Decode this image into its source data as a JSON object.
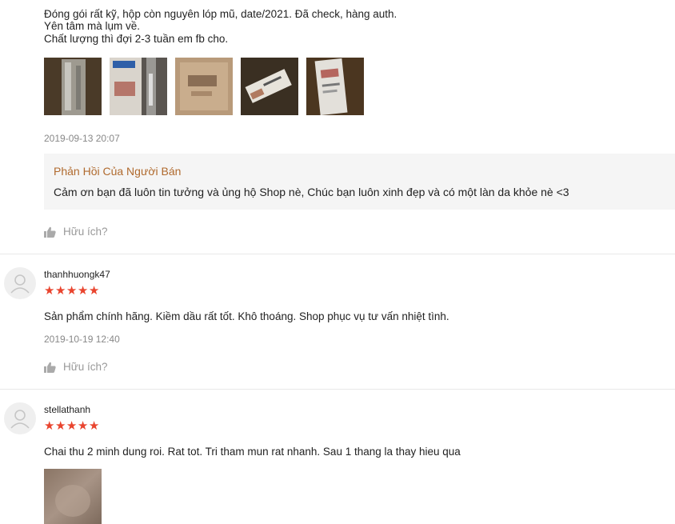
{
  "review1": {
    "lines": [
      "Đóng gói rất kỹ, hộp còn nguyên lóp mũ, date/2021. Đã check, hàng auth.",
      "Yên tâm mà lụm về.",
      "Chất lượng thì đợi 2-3 tuần em fb cho."
    ],
    "timestamp": "2019-09-13 20:07",
    "photo_count": 5,
    "seller_reply": {
      "title": "Phản Hồi Của Người Bán",
      "text": "Cảm ơn bạn đã luôn tin tưởng và ủng hộ Shop nè, Chúc bạn luôn xinh đẹp và có một làn da khỏe nè <3"
    },
    "helpful_label": "Hữu ích?"
  },
  "review2": {
    "username": "thanhhuongk47",
    "rating": 5,
    "text": "Sản phẩm chính hãng. Kiềm dầu rất tốt. Khô thoáng. Shop phục vụ tư vấn nhiệt tình.",
    "timestamp": "2019-10-19 12:40",
    "helpful_label": "Hữu ích?"
  },
  "review3": {
    "username": "stellathanh",
    "rating": 5,
    "text": "Chai thu 2 minh dung roi. Rat tot. Tri tham mun rat nhanh. Sau 1 thang la thay hieu qua",
    "photo_count": 1
  },
  "colors": {
    "star": "#e9442e",
    "reply_title": "#b06a2e",
    "reply_bg": "#f5f5f5"
  },
  "icons": {
    "helpful": "thumbs-up-icon",
    "avatar": "user-avatar-icon"
  }
}
